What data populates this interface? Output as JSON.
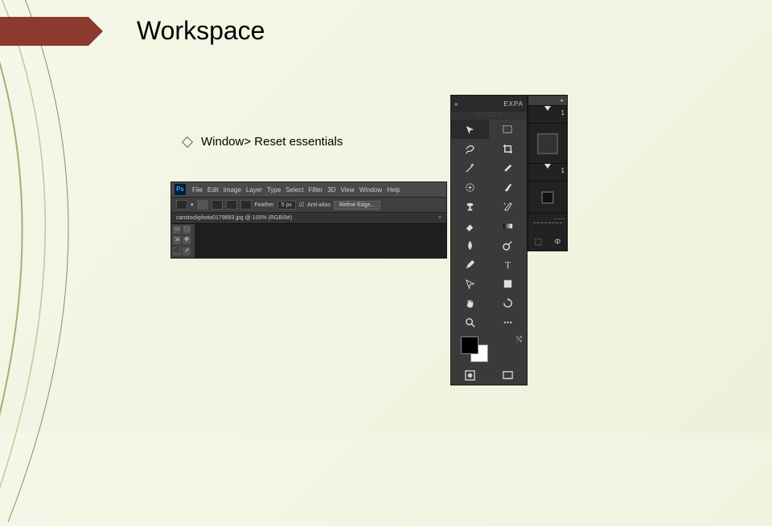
{
  "slide": {
    "title": "Workspace",
    "bullet": "Window> Reset essentials"
  },
  "ps_menu": {
    "logo": "Ps",
    "items": [
      "File",
      "Edit",
      "Image",
      "Layer",
      "Type",
      "Select",
      "Filter",
      "3D",
      "View",
      "Window",
      "Help"
    ],
    "options": {
      "feather_label": "Feather",
      "feather_value": "5 px",
      "antialias": "Anti-alias",
      "refine": "Refine Edge..."
    },
    "tab_title": "canstockphoto0179893.jpg @ 100% (RGB/8#)",
    "tab_close": "×"
  },
  "mini_tools": [
    "▭",
    "⬚",
    "⇲",
    "✥",
    "⬛",
    "↗"
  ],
  "toolbox": {
    "collapse": "«",
    "expand_label": "EXPA",
    "grip": ":::::::::",
    "rows": [
      {
        "a": {
          "name": "move-tool",
          "glyph": "move"
        },
        "b": {
          "name": "marquee-tool",
          "glyph": "rect"
        }
      },
      {
        "a": {
          "name": "lasso-tool",
          "glyph": "lasso"
        },
        "b": {
          "name": "crop-tool",
          "glyph": "crop"
        }
      },
      {
        "a": {
          "name": "wand-tool",
          "glyph": "wand"
        },
        "b": {
          "name": "eyedropper-tool",
          "glyph": "eyedrop"
        }
      },
      {
        "a": {
          "name": "healing-tool",
          "glyph": "patch"
        },
        "b": {
          "name": "brush-tool",
          "glyph": "brush"
        }
      },
      {
        "a": {
          "name": "stamp-tool",
          "glyph": "stamp"
        },
        "b": {
          "name": "history-brush-tool",
          "glyph": "hbrush"
        }
      },
      {
        "a": {
          "name": "eraser-tool",
          "glyph": "eraser"
        },
        "b": {
          "name": "gradient-tool",
          "glyph": "grad"
        }
      },
      {
        "a": {
          "name": "blur-tool",
          "glyph": "blur"
        },
        "b": {
          "name": "dodge-tool",
          "glyph": "dodge"
        }
      },
      {
        "a": {
          "name": "pen-tool",
          "glyph": "pen"
        },
        "b": {
          "name": "type-tool",
          "glyph": "T"
        }
      },
      {
        "a": {
          "name": "path-tool",
          "glyph": "path"
        },
        "b": {
          "name": "shape-tool",
          "glyph": "shape"
        }
      },
      {
        "a": {
          "name": "hand-tool",
          "glyph": "hand"
        },
        "b": {
          "name": "rotate-tool",
          "glyph": "rotate"
        }
      },
      {
        "a": {
          "name": "zoom-tool",
          "glyph": "zoom"
        },
        "b": {
          "name": "more-tool",
          "glyph": "dots"
        }
      }
    ],
    "foot": {
      "a": "quickmask-toggle",
      "b": "screenmode-toggle"
    }
  },
  "right_panel": {
    "tab": "▸",
    "hist_label": "1",
    "brush_label": "1",
    "foot_a": "⬚",
    "foot_b": "Φ"
  }
}
